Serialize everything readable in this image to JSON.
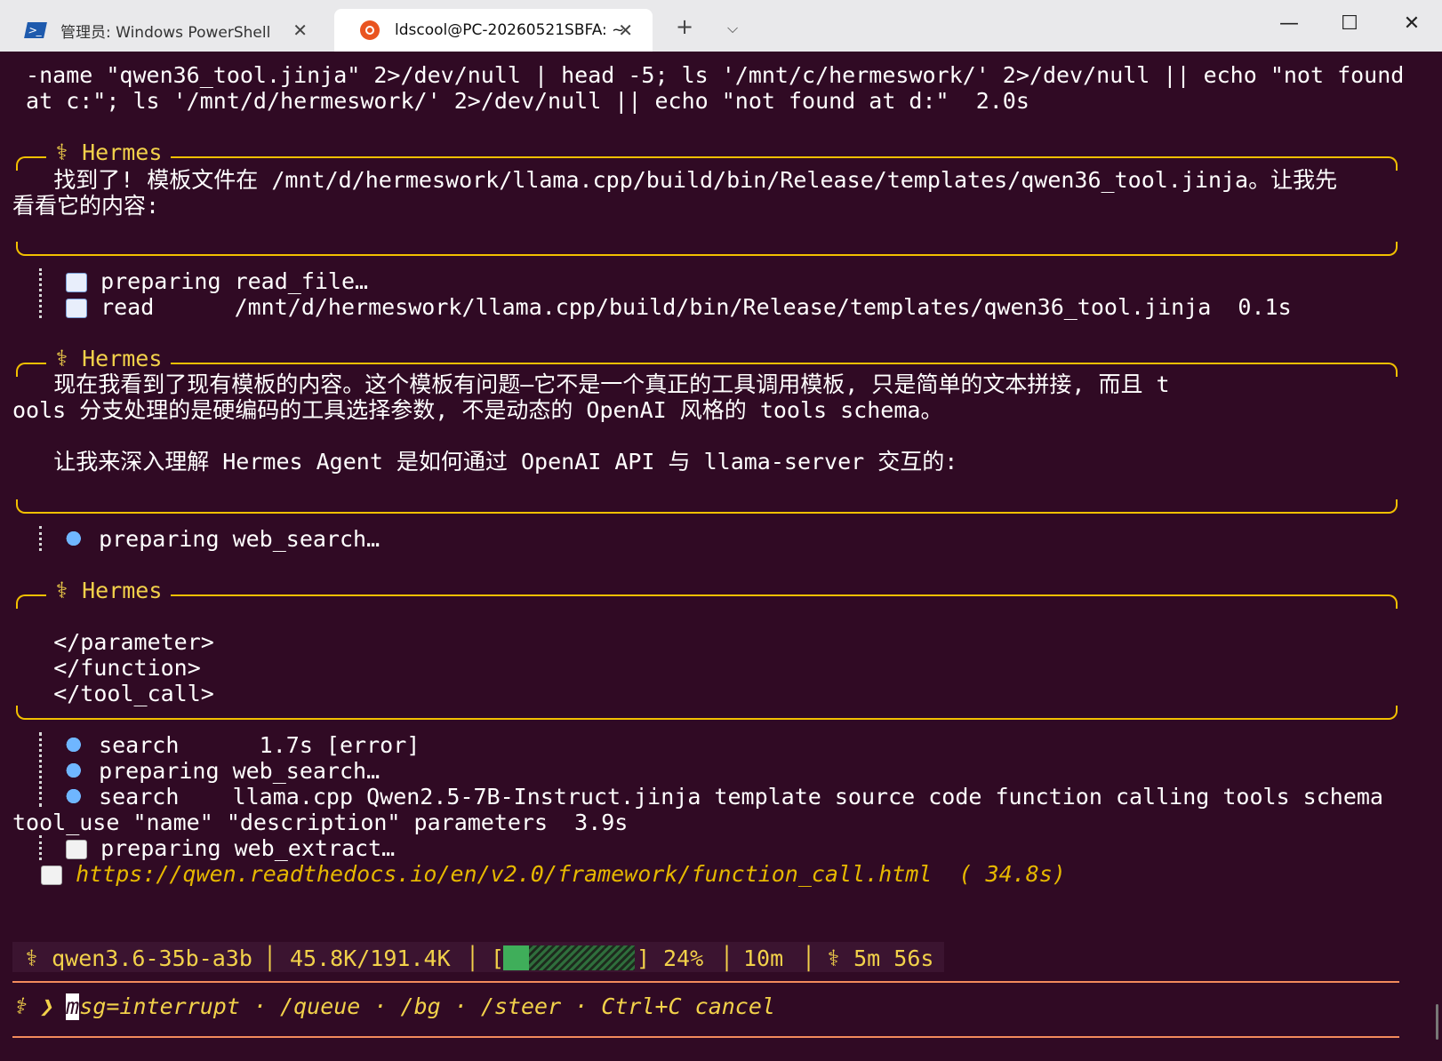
{
  "tabs": [
    {
      "label": "管理员: Windows PowerShell",
      "icon": "powershell-icon"
    },
    {
      "label": "ldscool@PC-20260521SBFA: ~",
      "icon": "ubuntu-icon"
    }
  ],
  "titlebar": {
    "new_tab": "+",
    "dropdown": "⌵",
    "minimize": "—",
    "maximize": "☐",
    "close": "✕",
    "tab_close": "✕"
  },
  "terminal": {
    "cmd_line1": " -name \"qwen36_tool.jinja\" 2>/dev/null | head -5; ls '/mnt/c/hermeswork/' 2>/dev/null || echo \"not found",
    "cmd_line2": " at c:\"; ls '/mnt/d/hermeswork/' 2>/dev/null || echo \"not found at d:\"  2.0s",
    "hermes_title": "⚕ Hermes",
    "block1_line1": "    找到了! 模板文件在 /mnt/d/hermeswork/llama.cpp/build/bin/Release/templates/qwen36_tool.jinja。让我先",
    "block1_line2": "看看它的内容:",
    "tool1_line1": "preparing read_file…",
    "tool1_line2": "read      /mnt/d/hermeswork/llama.cpp/build/bin/Release/templates/qwen36_tool.jinja  0.1s",
    "block2_line1": "    现在我看到了现有模板的内容。这个模板有问题—它不是一个真正的工具调用模板, 只是简单的文本拼接, 而且 t",
    "block2_line2": "ools 分支处理的是硬编码的工具选择参数, 不是动态的 OpenAI 风格的 tools schema。",
    "block2_line3": "    让我来深入理解 Hermes Agent 是如何通过 OpenAI API 与 llama-server 交互的:",
    "tool2_line1": "preparing web_search…",
    "block3_line1": "    </parameter>",
    "block3_line2": "    </function>",
    "block3_line3": "    </tool_call>",
    "tool3_line1": "search      1.7s [error]",
    "tool3_line2": "preparing web_search…",
    "tool3_line3": "search    llama.cpp Qwen2.5-7B-Instruct.jinja template source code function calling tools schema",
    "tool3_line4": "tool_use \"name\" \"description\" parameters  3.9s",
    "tool3_line5": "preparing web_extract…",
    "link_url": "https://qwen.readthedocs.io/en/v2.0/framework/function_call.html",
    "link_time": "  ( 34.8s)"
  },
  "status": {
    "model": "⚕ qwen3.6-35b-a3b",
    "tokens": "45.8K/191.4K",
    "context_fill_percent": 24,
    "percent_label": "24%",
    "bracket_open": "[",
    "bracket_close": "]",
    "elapsed": "10m",
    "timer": "5m 56s",
    "sep": "│"
  },
  "prompt": {
    "arrow": "⚕ ❯ ",
    "cursor_char": "m",
    "hint": "sg=interrupt · /queue · /bg · /steer · Ctrl+C cancel"
  },
  "colors": {
    "background": "#300a24",
    "accent": "#f2d14a",
    "border": "#f2c000",
    "divider": "#f28b5c"
  }
}
